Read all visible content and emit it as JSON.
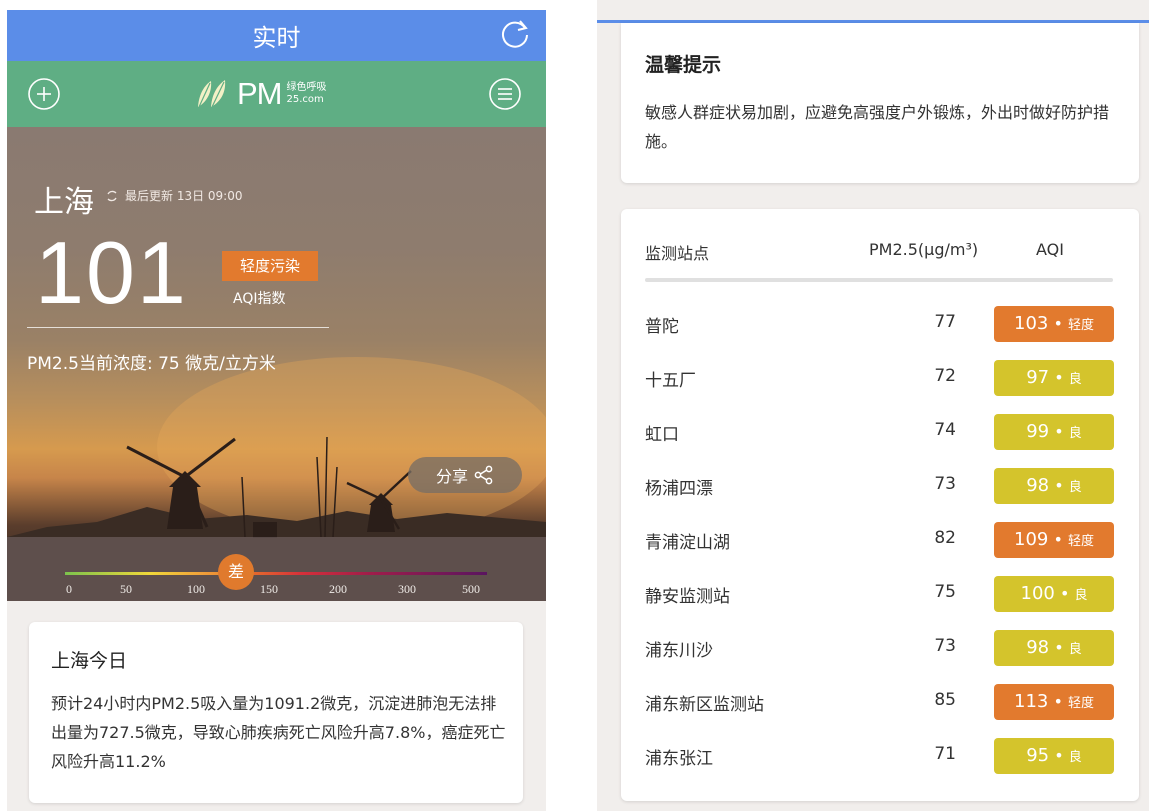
{
  "header": {
    "title": "实时"
  },
  "logo": {
    "text": "PM",
    "sub_top": "绿色呼吸",
    "sub_bottom": "25.com"
  },
  "hero": {
    "city": "上海",
    "update": "最后更新 13日 09:00",
    "aqi": "101",
    "level": "轻度污染",
    "aqi_label": "AQI指数",
    "pm_now": "PM2.5当前浓度: 75 微克/立方米",
    "share": "分享",
    "scale_marker": "差",
    "scale_ticks": [
      "0",
      "50",
      "100",
      "150",
      "200",
      "300",
      "500"
    ]
  },
  "today": {
    "title": "上海今日",
    "text": "预计24小时内PM2.5吸入量为1091.2微克，沉淀进肺泡无法排出量为727.5微克，导致心肺疾病死亡风险升高7.8%，癌症死亡风险升高11.2%"
  },
  "tip": {
    "title": "温馨提示",
    "text": "敏感人群症状易加剧，应避免高强度户外锻炼，外出时做好防护措施。"
  },
  "stations": {
    "headers": {
      "name": "监测站点",
      "pm": "PM2.5(μg/m³)",
      "aqi": "AQI"
    },
    "rows": [
      {
        "name": "普陀",
        "pm": "77",
        "aqi": "103",
        "level": "轻度",
        "color": "#e27a2e"
      },
      {
        "name": "十五厂",
        "pm": "72",
        "aqi": "97",
        "level": "良",
        "color": "#d4c42c"
      },
      {
        "name": "虹口",
        "pm": "74",
        "aqi": "99",
        "level": "良",
        "color": "#d4c42c"
      },
      {
        "name": "杨浦四漂",
        "pm": "73",
        "aqi": "98",
        "level": "良",
        "color": "#d4c42c"
      },
      {
        "name": "青浦淀山湖",
        "pm": "82",
        "aqi": "109",
        "level": "轻度",
        "color": "#e27a2e"
      },
      {
        "name": "静安监测站",
        "pm": "75",
        "aqi": "100",
        "level": "良",
        "color": "#d4c42c"
      },
      {
        "name": "浦东川沙",
        "pm": "73",
        "aqi": "98",
        "level": "良",
        "color": "#d4c42c"
      },
      {
        "name": "浦东新区监测站",
        "pm": "85",
        "aqi": "113",
        "level": "轻度",
        "color": "#e27a2e"
      },
      {
        "name": "浦东张江",
        "pm": "71",
        "aqi": "95",
        "level": "良",
        "color": "#d4c42c"
      }
    ]
  },
  "colors": {
    "topbar": "#5b8de8",
    "appbar": "#5fae84",
    "moderate": "#d4c42c",
    "light_pollution": "#e27a2e"
  },
  "icons": [
    "refresh-icon",
    "plus-icon",
    "menu-icon",
    "leaf-logo-icon",
    "sync-icon",
    "share-icon"
  ]
}
